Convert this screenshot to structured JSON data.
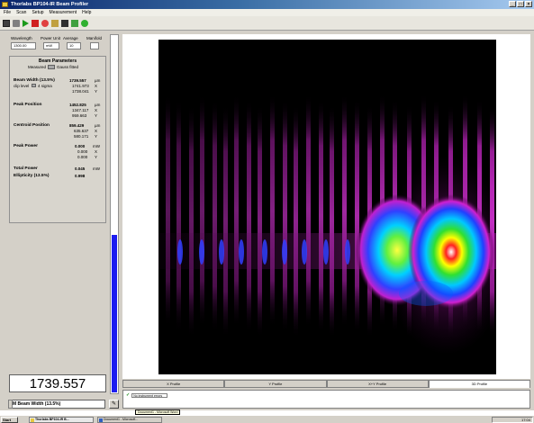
{
  "window": {
    "title": "Thorlabs BP104-IR Beam Profiler"
  },
  "menu": [
    "File",
    "Scan",
    "Setup",
    "Measurement",
    "Help"
  ],
  "toolbar": {
    "icons": [
      "save-icon",
      "print-icon",
      "play-icon",
      "stop-icon",
      "record-icon",
      "settings-icon",
      "scale-icon",
      "window-icon",
      "close-icon"
    ]
  },
  "controls": {
    "headers": [
      "Wavelength",
      "Power Unit",
      "Average",
      "Manifold"
    ],
    "wavelength": "1300.00",
    "power_unit": "mW",
    "average": "10"
  },
  "beam_params": {
    "title": "Beam Parameters",
    "toggle_left": "Measured",
    "toggle_right": "Gauss fitted",
    "beam_width_label": "Beam Width (13.5%)",
    "beam_width_value": "1739.557",
    "beam_width_unit": "µm",
    "beam_width_x": "1741.973",
    "beam_width_y": "1738.041",
    "clip_label": "clip level",
    "clip_value": "4 sigma",
    "peak_pos_label": "Peak Position",
    "peak_pos_value": "1452.825",
    "peak_pos_unit": "µm",
    "peak_pos_x": "1347.117",
    "peak_pos_y": "959.663",
    "centroid_label": "Centroid Position",
    "centroid_value": "859.429",
    "centroid_unit": "µm",
    "centroid_x": "635.637",
    "centroid_y": "580.171",
    "peak_power_label": "Peak Power",
    "peak_power_value": "0.000",
    "peak_power_unit": "mW",
    "peak_power_x": "0.000",
    "peak_power_y": "0.000",
    "total_power_label": "Total Power",
    "total_power_value": "0.045",
    "total_power_unit": "mW",
    "ellipticity_label": "Ellipticity (13.5%)",
    "ellipticity_value": "0.998",
    "axis_x": "X",
    "axis_y": "Y"
  },
  "big_value": "1739.557",
  "selector": "M Beam Width (13.5%)",
  "meter_level": 0.44,
  "tabs": [
    "X Profile",
    "Y Profile",
    "X+Y Profile",
    "3D Profile"
  ],
  "selected_tab": 3,
  "message": "No instrument errors",
  "tooltip": "Document1 - Microsoft Word",
  "taskbar": {
    "start": "Start",
    "tasks": [
      "Thorlabs BP104-IR B...",
      "Document1 - Microsoft..."
    ],
    "clock": "17:04"
  },
  "colors": {
    "meter_fill": "#1c1cf0",
    "title_start": "#0a246a",
    "title_end": "#a6caf0"
  }
}
